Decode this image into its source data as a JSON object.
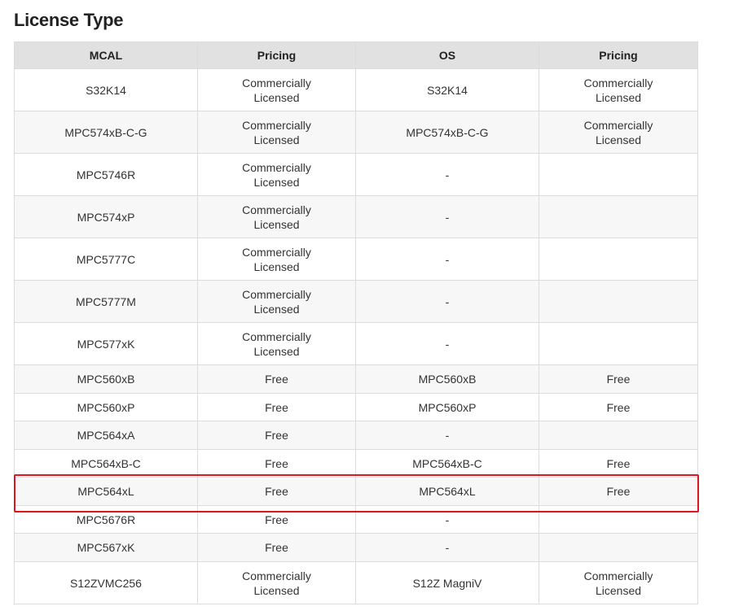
{
  "page": {
    "title": "License Type"
  },
  "table": {
    "headers": [
      "MCAL",
      "Pricing",
      "OS",
      "Pricing"
    ],
    "rows": [
      [
        "S32K14",
        "Commercially Licensed",
        "S32K14",
        "Commercially Licensed"
      ],
      [
        "MPC574xB-C-G",
        "Commercially Licensed",
        "MPC574xB-C-G",
        "Commercially Licensed"
      ],
      [
        "MPC5746R",
        "Commercially Licensed",
        "-",
        ""
      ],
      [
        "MPC574xP",
        "Commercially Licensed",
        "-",
        ""
      ],
      [
        "MPC5777C",
        "Commercially Licensed",
        "-",
        ""
      ],
      [
        "MPC5777M",
        "Commercially Licensed",
        "-",
        ""
      ],
      [
        "MPC577xK",
        "Commercially Licensed",
        "-",
        ""
      ],
      [
        "MPC560xB",
        "Free",
        "MPC560xB",
        "Free"
      ],
      [
        "MPC560xP",
        "Free",
        "MPC560xP",
        "Free"
      ],
      [
        "MPC564xA",
        "Free",
        "-",
        ""
      ],
      [
        "MPC564xB-C",
        "Free",
        "MPC564xB-C",
        "Free"
      ],
      [
        "MPC564xL",
        "Free",
        "MPC564xL",
        "Free"
      ],
      [
        "MPC5676R",
        "Free",
        "-",
        ""
      ],
      [
        "MPC567xK",
        "Free",
        "-",
        ""
      ],
      [
        "S12ZVMC256",
        "Commercially Licensed",
        "S12Z MagniV",
        "Commercially Licensed"
      ]
    ],
    "highlight_color": "#e0141e"
  }
}
